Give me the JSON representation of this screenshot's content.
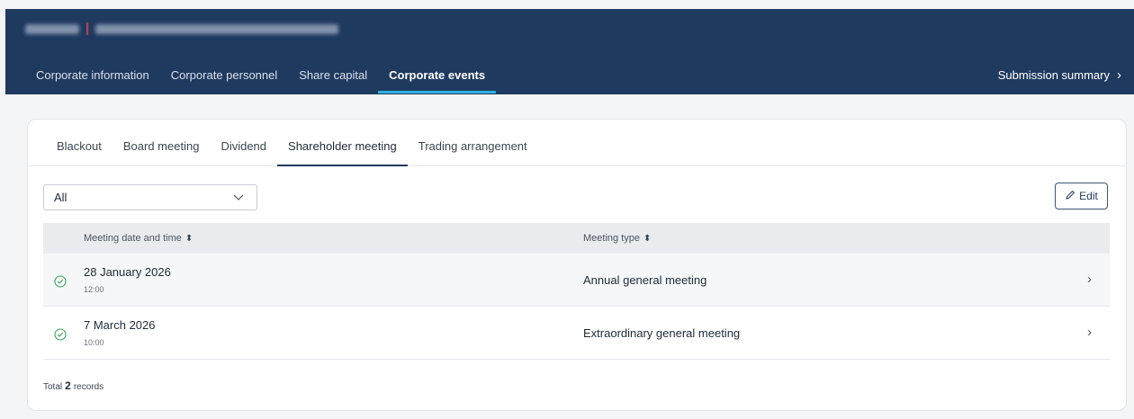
{
  "header": {
    "nav_tabs": [
      {
        "label": "Corporate information",
        "active": false
      },
      {
        "label": "Corporate personnel",
        "active": false
      },
      {
        "label": "Share capital",
        "active": false
      },
      {
        "label": "Corporate events",
        "active": true
      }
    ],
    "submission_label": "Submission summary",
    "colors": {
      "background": "#1f3a5f",
      "active_underline": "#2fb0e0"
    }
  },
  "sub_tabs": [
    {
      "label": "Blackout",
      "active": false
    },
    {
      "label": "Board meeting",
      "active": false
    },
    {
      "label": "Dividend",
      "active": false
    },
    {
      "label": "Shareholder meeting",
      "active": true
    },
    {
      "label": "Trading arrangement",
      "active": false
    }
  ],
  "filter": {
    "selected": "All",
    "icon": "chevron-down-icon"
  },
  "edit_label": "Edit",
  "table": {
    "columns": [
      "Meeting date and time",
      "Meeting type"
    ],
    "rows": [
      {
        "date": "28 January 2026",
        "time": "12:00",
        "type": "Annual general meeting",
        "status": "check-circle-icon"
      },
      {
        "date": "7 March 2026",
        "time": "10:00",
        "type": "Extraordinary general meeting",
        "status": "check-circle-icon"
      }
    ]
  },
  "footer": {
    "prefix": "Total",
    "count": "2",
    "suffix": "records"
  },
  "status_color": "#3aa657"
}
